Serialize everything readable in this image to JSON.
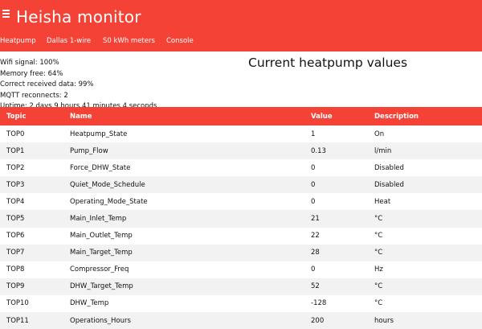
{
  "header": {
    "title": "Heisha monitor",
    "menu_icon": "hamburger-menu-icon",
    "accent_color": "#f44336"
  },
  "nav": [
    {
      "label": "Heatpump"
    },
    {
      "label": "Dallas 1-wire"
    },
    {
      "label": "S0 kWh meters"
    },
    {
      "label": "Console"
    }
  ],
  "status": {
    "wifi": "Wifi signal: 100%",
    "memory": "Memory free: 64%",
    "received": "Correct received data: 99%",
    "mqtt": "MQTT reconnects: 2",
    "uptime": "Uptime: 2 days 9 hours 41 minutes 4 seconds"
  },
  "section_title": "Current heatpump values",
  "table": {
    "columns": [
      "Topic",
      "Name",
      "Value",
      "Description"
    ],
    "rows": [
      [
        "TOP0",
        "Heatpump_State",
        "1",
        "On"
      ],
      [
        "TOP1",
        "Pump_Flow",
        "0.13",
        "l/min"
      ],
      [
        "TOP2",
        "Force_DHW_State",
        "0",
        "Disabled"
      ],
      [
        "TOP3",
        "Quiet_Mode_Schedule",
        "0",
        "Disabled"
      ],
      [
        "TOP4",
        "Operating_Mode_State",
        "0",
        "Heat"
      ],
      [
        "TOP5",
        "Main_Inlet_Temp",
        "21",
        "°C"
      ],
      [
        "TOP6",
        "Main_Outlet_Temp",
        "22",
        "°C"
      ],
      [
        "TOP7",
        "Main_Target_Temp",
        "28",
        "°C"
      ],
      [
        "TOP8",
        "Compressor_Freq",
        "0",
        "Hz"
      ],
      [
        "TOP9",
        "DHW_Target_Temp",
        "52",
        "°C"
      ],
      [
        "TOP10",
        "DHW_Temp",
        "-128",
        "°C"
      ],
      [
        "TOP11",
        "Operations_Hours",
        "200",
        "hours"
      ]
    ]
  }
}
